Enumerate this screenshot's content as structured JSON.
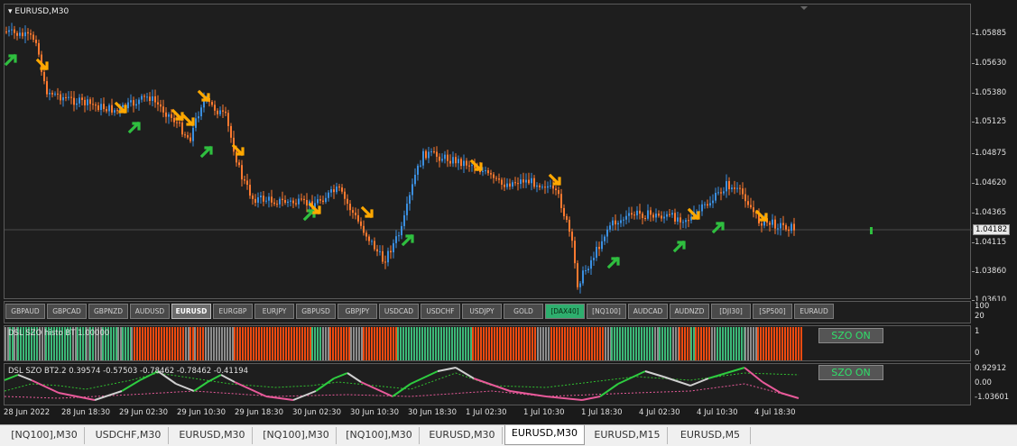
{
  "main": {
    "title": "EURUSD,M30",
    "price_scale": [
      "1.05885",
      "1.05630",
      "1.05380",
      "1.05125",
      "1.04875",
      "1.04620",
      "1.04365",
      "1.04115",
      "1.03860",
      "1.03610"
    ],
    "current_price": "1.04182",
    "colors": {
      "up": "#3b8fe0",
      "down": "#ff7a30",
      "buy_arrow": "#2fbf3f",
      "sell_arrow": "#ffa800"
    }
  },
  "symbols": {
    "buttons": [
      "GBPAUD",
      "GBPCAD",
      "GBPNZD",
      "AUDUSD",
      "EURUSD",
      "EURGBP",
      "EURJPY",
      "GBPUSD",
      "GBPJPY",
      "USDCAD",
      "USDCHF",
      "USDJPY",
      "GOLD",
      "[DAX40]",
      "[NQ100]",
      "AUDCAD",
      "AUDNZD",
      "[DJI30]",
      "[SP500]",
      "EURAUD"
    ],
    "active": "EURUSD",
    "highlighted": "[DAX40]",
    "scale": [
      "100",
      "20"
    ]
  },
  "histo": {
    "label": "DSL SZO histo BT 1.00000",
    "button": "SZO ON",
    "scale": [
      "1",
      "0"
    ],
    "colors": {
      "bull": "#3cb878",
      "bear": "#f04a10",
      "neutral": "#8c8c8c"
    }
  },
  "osc": {
    "label": "DSL SZO BT2.2 0.39574 -0.57503 -0.78462 -0.78462 -0.41194",
    "button": "SZO ON",
    "scale": [
      "0.92912",
      "0.00",
      "-1.03601"
    ],
    "colors": {
      "up": "#2ecc40",
      "down": "#e85a9a",
      "neutral": "#d0d0d0",
      "levels": "#30c030"
    }
  },
  "time_axis": [
    "28 Jun 2022",
    "28 Jun 18:30",
    "29 Jun 02:30",
    "29 Jun 10:30",
    "29 Jun 18:30",
    "30 Jun 02:30",
    "30 Jun 10:30",
    "30 Jun 18:30",
    "1 Jul 02:30",
    "1 Jul 10:30",
    "1 Jul 18:30",
    "4 Jul 02:30",
    "4 Jul 10:30",
    "4 Jul 18:30"
  ],
  "tabs": [
    "[NQ100],M30",
    "USDCHF,M30",
    "EURUSD,M30",
    "[NQ100],M30",
    "[NQ100],M30",
    "EURUSD,M30",
    "EURUSD,M30",
    "EURUSD,M15",
    "EURUSD,M5"
  ],
  "active_tab_index": 6
}
